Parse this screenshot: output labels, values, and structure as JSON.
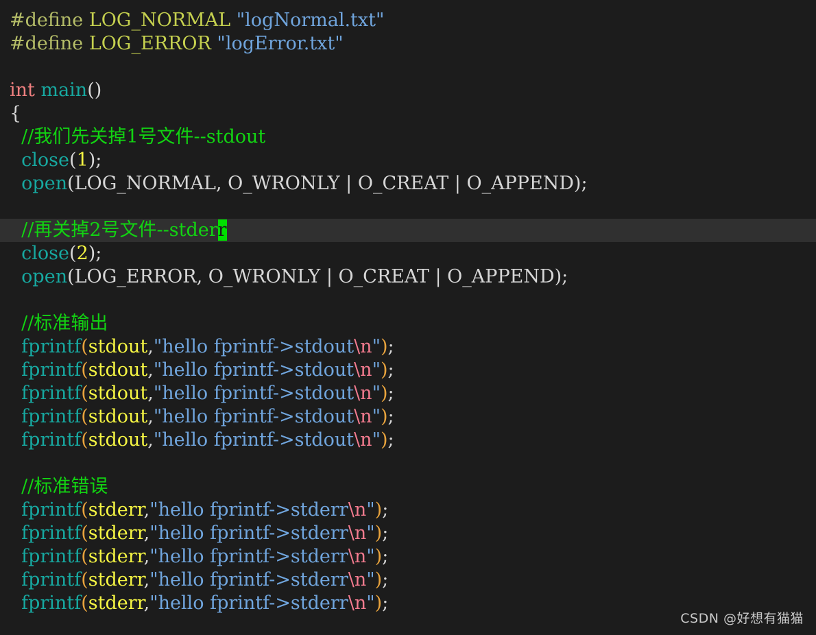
{
  "editor": {
    "background_color": "#1c1c1c",
    "current_line_background": "#303030",
    "cursor_color": "#00e000",
    "language": "C"
  },
  "colors": {
    "preprocessor": "#b5bd68",
    "macro_name": "#c5d04f",
    "string": "#70a5dd",
    "keyword": "#f08080",
    "function": "#17a8a0",
    "plain": "#d7d7d7",
    "number": "#f5f543",
    "comment": "#12d312",
    "variable": "#f5f543",
    "paren": "#e8a33d",
    "escape": "#f47b8f"
  },
  "code": {
    "lines": [
      {
        "n": 1,
        "current": false,
        "tokens": [
          {
            "t": "#define ",
            "c": "t-pre"
          },
          {
            "t": "LOG_NORMAL ",
            "c": "t-macro"
          },
          {
            "t": "\"logNormal.txt\"",
            "c": "t-string"
          }
        ]
      },
      {
        "n": 2,
        "current": false,
        "tokens": [
          {
            "t": "#define ",
            "c": "t-pre"
          },
          {
            "t": "LOG_ERROR ",
            "c": "t-macro"
          },
          {
            "t": "\"logError.txt\"",
            "c": "t-string"
          }
        ]
      },
      {
        "n": 3,
        "current": false,
        "tokens": []
      },
      {
        "n": 4,
        "current": false,
        "tokens": [
          {
            "t": "int ",
            "c": "t-kw"
          },
          {
            "t": "main",
            "c": "t-fn"
          },
          {
            "t": "()",
            "c": "t-plain"
          }
        ]
      },
      {
        "n": 5,
        "current": false,
        "tokens": [
          {
            "t": "{",
            "c": "t-brace"
          }
        ]
      },
      {
        "n": 6,
        "current": false,
        "tokens": [
          {
            "t": "  //我们先关掉1号文件--stdout",
            "c": "t-comment"
          }
        ]
      },
      {
        "n": 7,
        "current": false,
        "tokens": [
          {
            "t": "  ",
            "c": "t-plain"
          },
          {
            "t": "close",
            "c": "t-fn"
          },
          {
            "t": "(",
            "c": "t-plain"
          },
          {
            "t": "1",
            "c": "t-num"
          },
          {
            "t": ");",
            "c": "t-plain"
          }
        ]
      },
      {
        "n": 8,
        "current": false,
        "tokens": [
          {
            "t": "  ",
            "c": "t-plain"
          },
          {
            "t": "open",
            "c": "t-fn"
          },
          {
            "t": "(LOG_NORMAL, O_WRONLY | O_CREAT | O_APPEND);",
            "c": "t-plain"
          }
        ]
      },
      {
        "n": 9,
        "current": false,
        "tokens": []
      },
      {
        "n": 10,
        "current": true,
        "tokens": [
          {
            "t": "  //再关掉2号文件--stder",
            "c": "t-comment"
          },
          {
            "t": "r",
            "c": "t-comment cursor"
          }
        ]
      },
      {
        "n": 11,
        "current": false,
        "tokens": [
          {
            "t": "  ",
            "c": "t-plain"
          },
          {
            "t": "close",
            "c": "t-fn"
          },
          {
            "t": "(",
            "c": "t-plain"
          },
          {
            "t": "2",
            "c": "t-num"
          },
          {
            "t": ");",
            "c": "t-plain"
          }
        ]
      },
      {
        "n": 12,
        "current": false,
        "tokens": [
          {
            "t": "  ",
            "c": "t-plain"
          },
          {
            "t": "open",
            "c": "t-fn"
          },
          {
            "t": "(LOG_ERROR, O_WRONLY | O_CREAT | O_APPEND);",
            "c": "t-plain"
          }
        ]
      },
      {
        "n": 13,
        "current": false,
        "tokens": []
      },
      {
        "n": 14,
        "current": false,
        "tokens": [
          {
            "t": "  //标准输出",
            "c": "t-comment"
          }
        ]
      },
      {
        "n": 15,
        "current": false,
        "tokens": [
          {
            "t": "  ",
            "c": "t-plain"
          },
          {
            "t": "fprintf",
            "c": "t-fn"
          },
          {
            "t": "(",
            "c": "t-paren"
          },
          {
            "t": "stdout",
            "c": "t-var"
          },
          {
            "t": ",",
            "c": "t-plain"
          },
          {
            "t": "\"hello fprintf->stdout",
            "c": "t-string"
          },
          {
            "t": "\\n",
            "c": "t-esc"
          },
          {
            "t": "\"",
            "c": "t-string"
          },
          {
            "t": ")",
            "c": "t-paren"
          },
          {
            "t": ";",
            "c": "t-plain"
          }
        ]
      },
      {
        "n": 16,
        "current": false,
        "tokens": [
          {
            "t": "  ",
            "c": "t-plain"
          },
          {
            "t": "fprintf",
            "c": "t-fn"
          },
          {
            "t": "(",
            "c": "t-paren"
          },
          {
            "t": "stdout",
            "c": "t-var"
          },
          {
            "t": ",",
            "c": "t-plain"
          },
          {
            "t": "\"hello fprintf->stdout",
            "c": "t-string"
          },
          {
            "t": "\\n",
            "c": "t-esc"
          },
          {
            "t": "\"",
            "c": "t-string"
          },
          {
            "t": ")",
            "c": "t-paren"
          },
          {
            "t": ";",
            "c": "t-plain"
          }
        ]
      },
      {
        "n": 17,
        "current": false,
        "tokens": [
          {
            "t": "  ",
            "c": "t-plain"
          },
          {
            "t": "fprintf",
            "c": "t-fn"
          },
          {
            "t": "(",
            "c": "t-paren"
          },
          {
            "t": "stdout",
            "c": "t-var"
          },
          {
            "t": ",",
            "c": "t-plain"
          },
          {
            "t": "\"hello fprintf->stdout",
            "c": "t-string"
          },
          {
            "t": "\\n",
            "c": "t-esc"
          },
          {
            "t": "\"",
            "c": "t-string"
          },
          {
            "t": ")",
            "c": "t-paren"
          },
          {
            "t": ";",
            "c": "t-plain"
          }
        ]
      },
      {
        "n": 18,
        "current": false,
        "tokens": [
          {
            "t": "  ",
            "c": "t-plain"
          },
          {
            "t": "fprintf",
            "c": "t-fn"
          },
          {
            "t": "(",
            "c": "t-paren"
          },
          {
            "t": "stdout",
            "c": "t-var"
          },
          {
            "t": ",",
            "c": "t-plain"
          },
          {
            "t": "\"hello fprintf->stdout",
            "c": "t-string"
          },
          {
            "t": "\\n",
            "c": "t-esc"
          },
          {
            "t": "\"",
            "c": "t-string"
          },
          {
            "t": ")",
            "c": "t-paren"
          },
          {
            "t": ";",
            "c": "t-plain"
          }
        ]
      },
      {
        "n": 19,
        "current": false,
        "tokens": [
          {
            "t": "  ",
            "c": "t-plain"
          },
          {
            "t": "fprintf",
            "c": "t-fn"
          },
          {
            "t": "(",
            "c": "t-paren"
          },
          {
            "t": "stdout",
            "c": "t-var"
          },
          {
            "t": ",",
            "c": "t-plain"
          },
          {
            "t": "\"hello fprintf->stdout",
            "c": "t-string"
          },
          {
            "t": "\\n",
            "c": "t-esc"
          },
          {
            "t": "\"",
            "c": "t-string"
          },
          {
            "t": ")",
            "c": "t-paren"
          },
          {
            "t": ";",
            "c": "t-plain"
          }
        ]
      },
      {
        "n": 20,
        "current": false,
        "tokens": []
      },
      {
        "n": 21,
        "current": false,
        "tokens": [
          {
            "t": "  //标准错误",
            "c": "t-comment"
          }
        ]
      },
      {
        "n": 22,
        "current": false,
        "tokens": [
          {
            "t": "  ",
            "c": "t-plain"
          },
          {
            "t": "fprintf",
            "c": "t-fn"
          },
          {
            "t": "(",
            "c": "t-paren"
          },
          {
            "t": "stderr",
            "c": "t-var"
          },
          {
            "t": ",",
            "c": "t-plain"
          },
          {
            "t": "\"hello fprintf->stderr",
            "c": "t-string"
          },
          {
            "t": "\\n",
            "c": "t-esc"
          },
          {
            "t": "\"",
            "c": "t-string"
          },
          {
            "t": ")",
            "c": "t-paren"
          },
          {
            "t": ";",
            "c": "t-plain"
          }
        ]
      },
      {
        "n": 23,
        "current": false,
        "tokens": [
          {
            "t": "  ",
            "c": "t-plain"
          },
          {
            "t": "fprintf",
            "c": "t-fn"
          },
          {
            "t": "(",
            "c": "t-paren"
          },
          {
            "t": "stderr",
            "c": "t-var"
          },
          {
            "t": ",",
            "c": "t-plain"
          },
          {
            "t": "\"hello fprintf->stderr",
            "c": "t-string"
          },
          {
            "t": "\\n",
            "c": "t-esc"
          },
          {
            "t": "\"",
            "c": "t-string"
          },
          {
            "t": ")",
            "c": "t-paren"
          },
          {
            "t": ";",
            "c": "t-plain"
          }
        ]
      },
      {
        "n": 24,
        "current": false,
        "tokens": [
          {
            "t": "  ",
            "c": "t-plain"
          },
          {
            "t": "fprintf",
            "c": "t-fn"
          },
          {
            "t": "(",
            "c": "t-paren"
          },
          {
            "t": "stderr",
            "c": "t-var"
          },
          {
            "t": ",",
            "c": "t-plain"
          },
          {
            "t": "\"hello fprintf->stderr",
            "c": "t-string"
          },
          {
            "t": "\\n",
            "c": "t-esc"
          },
          {
            "t": "\"",
            "c": "t-string"
          },
          {
            "t": ")",
            "c": "t-paren"
          },
          {
            "t": ";",
            "c": "t-plain"
          }
        ]
      },
      {
        "n": 25,
        "current": false,
        "tokens": [
          {
            "t": "  ",
            "c": "t-plain"
          },
          {
            "t": "fprintf",
            "c": "t-fn"
          },
          {
            "t": "(",
            "c": "t-paren"
          },
          {
            "t": "stderr",
            "c": "t-var"
          },
          {
            "t": ",",
            "c": "t-plain"
          },
          {
            "t": "\"hello fprintf->stderr",
            "c": "t-string"
          },
          {
            "t": "\\n",
            "c": "t-esc"
          },
          {
            "t": "\"",
            "c": "t-string"
          },
          {
            "t": ")",
            "c": "t-paren"
          },
          {
            "t": ";",
            "c": "t-plain"
          }
        ]
      },
      {
        "n": 26,
        "current": false,
        "tokens": [
          {
            "t": "  ",
            "c": "t-plain"
          },
          {
            "t": "fprintf",
            "c": "t-fn"
          },
          {
            "t": "(",
            "c": "t-paren"
          },
          {
            "t": "stderr",
            "c": "t-var"
          },
          {
            "t": ",",
            "c": "t-plain"
          },
          {
            "t": "\"hello fprintf->stderr",
            "c": "t-string"
          },
          {
            "t": "\\n",
            "c": "t-esc"
          },
          {
            "t": "\"",
            "c": "t-string"
          },
          {
            "t": ")",
            "c": "t-paren"
          },
          {
            "t": ";",
            "c": "t-plain"
          }
        ]
      }
    ]
  },
  "watermark": {
    "text": "CSDN @好想有猫猫"
  }
}
